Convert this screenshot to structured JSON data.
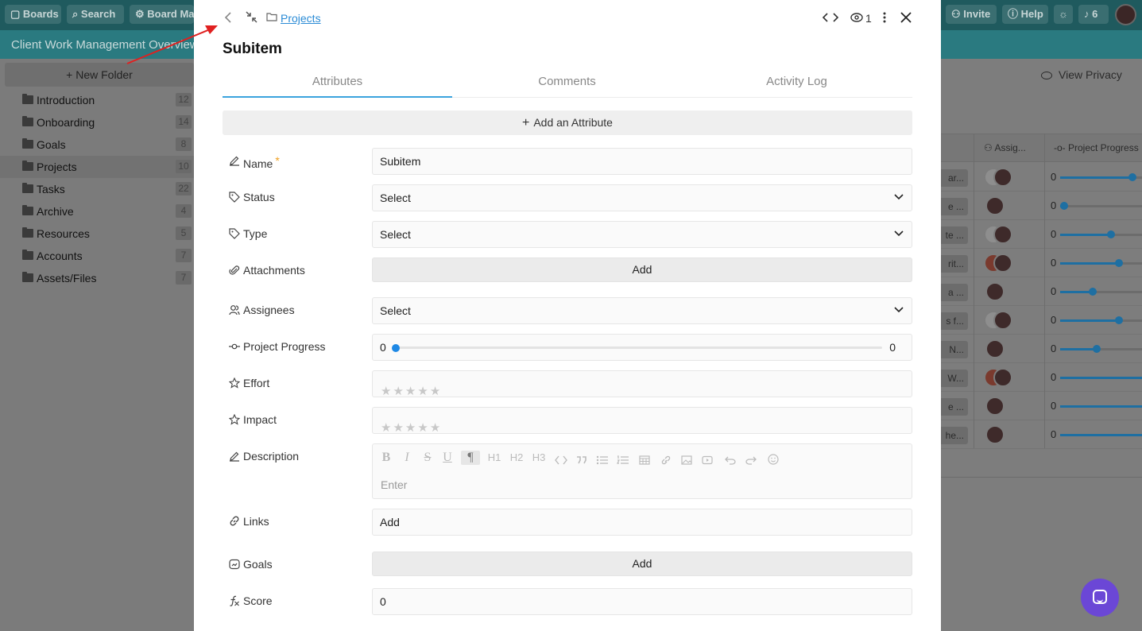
{
  "topbar": {
    "boards": "Boards",
    "search": "Search",
    "board_manage": "Board Mar",
    "invite": "Invite",
    "help": "Help",
    "notifications": "6"
  },
  "page_title": "Client Work Management Overview",
  "sidebar": {
    "new_folder": "New Folder",
    "folders": [
      {
        "label": "Introduction",
        "count": "12"
      },
      {
        "label": "Onboarding",
        "count": "14"
      },
      {
        "label": "Goals",
        "count": "8"
      },
      {
        "label": "Projects",
        "count": "10"
      },
      {
        "label": "Tasks",
        "count": "22"
      },
      {
        "label": "Archive",
        "count": "4"
      },
      {
        "label": "Resources",
        "count": "5"
      },
      {
        "label": "Accounts",
        "count": "7"
      },
      {
        "label": "Assets/Files",
        "count": "7"
      }
    ]
  },
  "right_pane": {
    "view_privacy": "View Privacy",
    "col_assignees": "Assig...",
    "col_progress": "Project Progress",
    "rows": [
      {
        "chip": "ar...",
        "progress": "0",
        "level": 0.88
      },
      {
        "chip": "e ...",
        "progress": "0",
        "level": 0.05
      },
      {
        "chip": "te ...",
        "progress": "0",
        "level": 0.62
      },
      {
        "chip": "rit...",
        "progress": "0",
        "level": 0.72
      },
      {
        "chip": "a ...",
        "progress": "0",
        "level": 0.4
      },
      {
        "chip": "s f...",
        "progress": "0",
        "level": 0.72
      },
      {
        "chip": "N...",
        "progress": "0",
        "level": 0.45
      },
      {
        "chip": "W...",
        "progress": "0",
        "level": 1.0
      },
      {
        "chip": "e ...",
        "progress": "0",
        "level": 1.0
      },
      {
        "chip": "he...",
        "progress": "0",
        "level": 1.0
      }
    ]
  },
  "modal": {
    "breadcrumb": "Projects",
    "watchers": "1",
    "title": "Subitem",
    "tabs": [
      "Attributes",
      "Comments",
      "Activity Log"
    ],
    "add_attribute": "Add an Attribute",
    "fields": {
      "name": {
        "label": "Name",
        "required": "*",
        "value": "Subitem"
      },
      "status": {
        "label": "Status",
        "value": "Select"
      },
      "type": {
        "label": "Type",
        "value": "Select"
      },
      "attachments": {
        "label": "Attachments",
        "button": "Add"
      },
      "assignees": {
        "label": "Assignees",
        "value": "Select"
      },
      "project_progress": {
        "label": "Project Progress",
        "min": "0",
        "max": "0",
        "value": 0
      },
      "effort": {
        "label": "Effort",
        "rating": 0,
        "max_rating": 5
      },
      "impact": {
        "label": "Impact",
        "rating": 0,
        "max_rating": 5
      },
      "description": {
        "label": "Description",
        "placeholder": "Enter"
      },
      "links": {
        "label": "Links",
        "value": "Add"
      },
      "goals": {
        "label": "Goals",
        "button": "Add"
      },
      "score": {
        "label": "Score",
        "value": "0"
      }
    },
    "editor_toolbar": [
      "B",
      "I",
      "S",
      "U",
      "¶",
      "H1",
      "H2",
      "H3"
    ]
  },
  "colors": {
    "accent": "#3ba3dd",
    "link": "#2a8bd6",
    "required": "#f0a020",
    "slider": "#1e88e5",
    "chat": "#6b47d6",
    "annotation_arrow": "#e02020"
  }
}
